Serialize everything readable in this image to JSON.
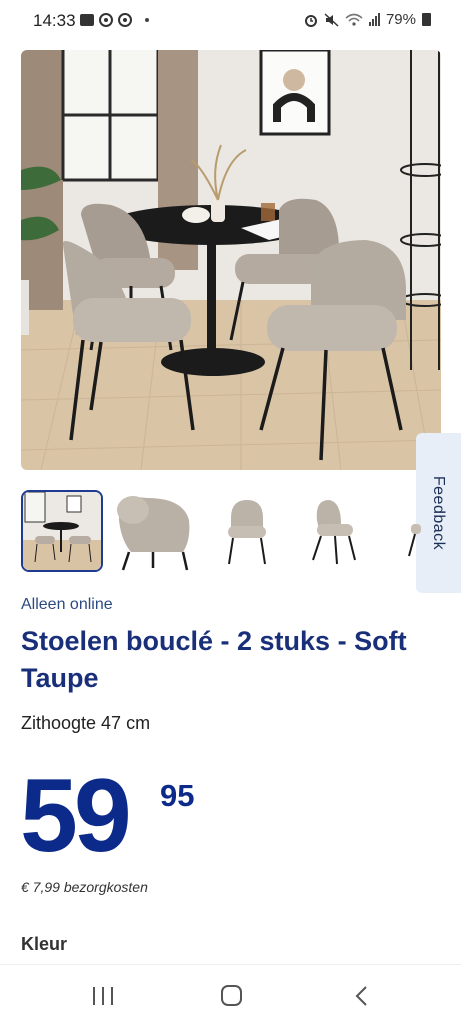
{
  "status_bar": {
    "time": "14:33",
    "battery": "79%",
    "icons_left": [
      "gallery-icon",
      "pinterest-icon",
      "pinterest-icon",
      "dot-icon"
    ],
    "icons_right": [
      "alarm-icon",
      "mute-icon",
      "wifi-icon",
      "signal-icon",
      "battery-icon"
    ]
  },
  "product": {
    "tag": "Alleen online",
    "title": "Stoelen bouclé - 2 stuks - Soft Taupe",
    "subtitle": "Zithoogte 47 cm",
    "price_main": "59",
    "price_decimals": "95",
    "shipping": "€ 7,99 bezorgkosten",
    "section_label": "Kleur"
  },
  "gallery": {
    "active_index": 0,
    "thumbnails": [
      "dining-room-scene",
      "chair-back-view",
      "chair-front-view",
      "chair-side-view",
      "chair-partial-view"
    ]
  },
  "feedback": {
    "label": "Feedback"
  },
  "colors": {
    "brand_blue": "#0c2a8a",
    "title_blue": "#1a2f7a",
    "feedback_bg": "#e8eef7"
  },
  "nav_bar": {
    "buttons": [
      "recents-button",
      "home-button",
      "back-button"
    ]
  }
}
